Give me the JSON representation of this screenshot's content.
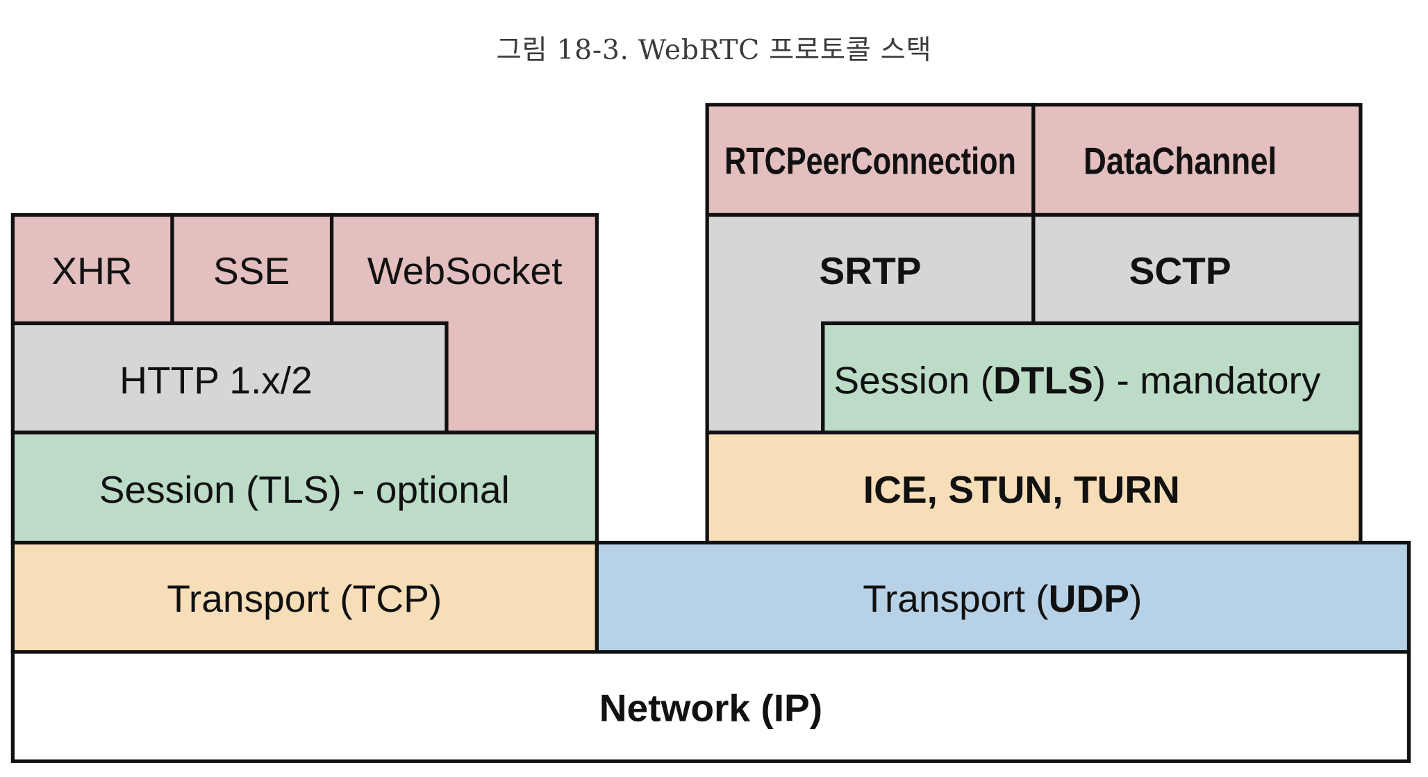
{
  "caption": "그림 18-3. WebRTC 프로토콜 스택",
  "colors": {
    "application": "#e3bfbf",
    "protocol": "#d6d6d6",
    "session": "#bcdcc7",
    "transport_tcp": "#f6deb9",
    "transport_udp": "#b7d2e7",
    "network": "#ffffff",
    "border": "#111111"
  },
  "left_stack": {
    "xhr": "XHR",
    "sse": "SSE",
    "websocket": "WebSocket",
    "http": "HTTP 1.x/2",
    "session_tls": "Session (TLS) - optional",
    "transport_tcp": "Transport (TCP)"
  },
  "right_stack": {
    "rtcpeerconnection": "RTCPeerConnection",
    "datachannel": "DataChannel",
    "srtp": "SRTP",
    "sctp": "SCTP",
    "session_dtls_prefix": "Session (",
    "session_dtls_bold": "DTLS",
    "session_dtls_suffix": ") - mandatory",
    "ice": "ICE, STUN, TURN",
    "transport_udp_prefix": "Transport (",
    "transport_udp_bold": "UDP",
    "transport_udp_suffix": ")"
  },
  "network": "Network (IP)"
}
